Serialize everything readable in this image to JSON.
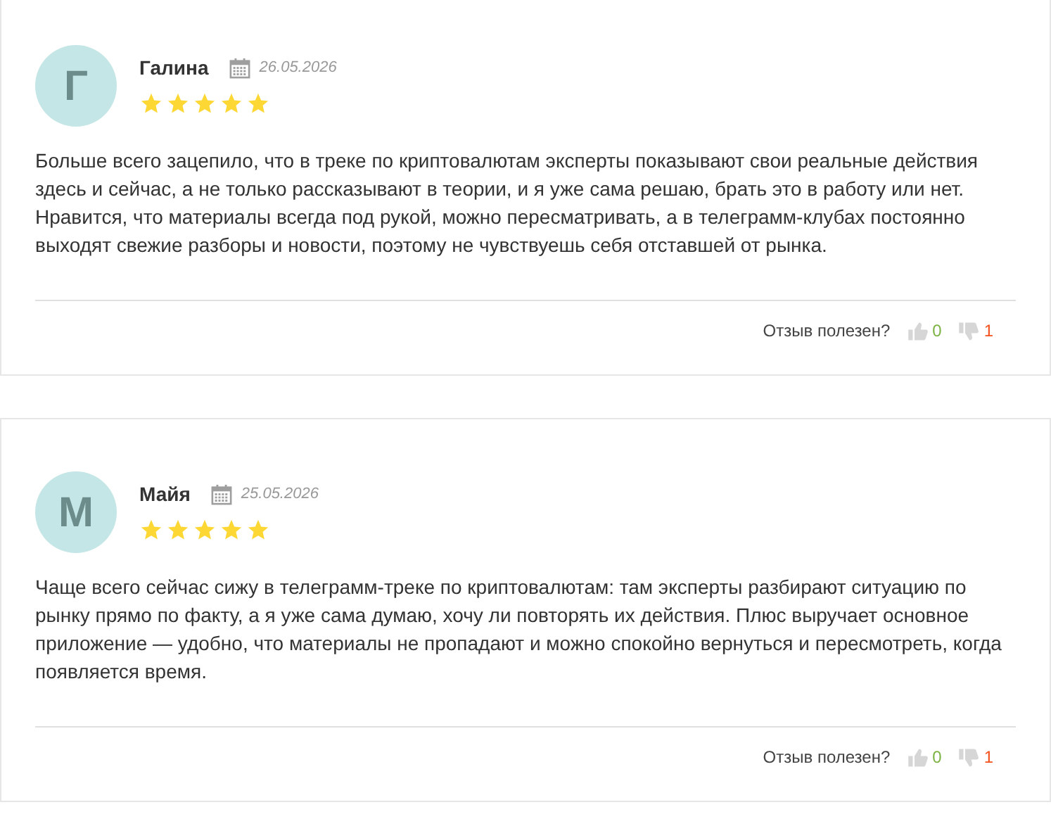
{
  "reviews": [
    {
      "initial": "Г",
      "name": "Галина",
      "date": "26.05.2026",
      "stars": 5,
      "text": "Больше всего зацепило, что в треке по криптовалютам эксперты показывают свои реальные действия здесь и сейчас, а не только рассказывают в теории, и я уже сама решаю, брать это в работу или нет. Нравится, что материалы всегда под рукой, можно пересматривать, а в телеграмм-клубах постоянно выходят свежие разборы и новости, поэтому не чувствуешь себя отставшей от рынка.",
      "helpful_label": "Отзыв полезен?",
      "likes": "0",
      "dislikes": "1"
    },
    {
      "initial": "М",
      "name": "Майя",
      "date": "25.05.2026",
      "stars": 5,
      "text": "Чаще всего сейчас сижу в телеграмм-треке по криптовалютам: там эксперты разбирают ситуацию по рынку прямо по факту, а я уже сама думаю, хочу ли повторять их действия. Плюс выручает основное приложение — удобно, что материалы не пропадают и можно спокойно вернуться и пересмотреть, когда появляется время.",
      "helpful_label": "Отзыв полезен?",
      "likes": "0",
      "dislikes": "1"
    }
  ]
}
